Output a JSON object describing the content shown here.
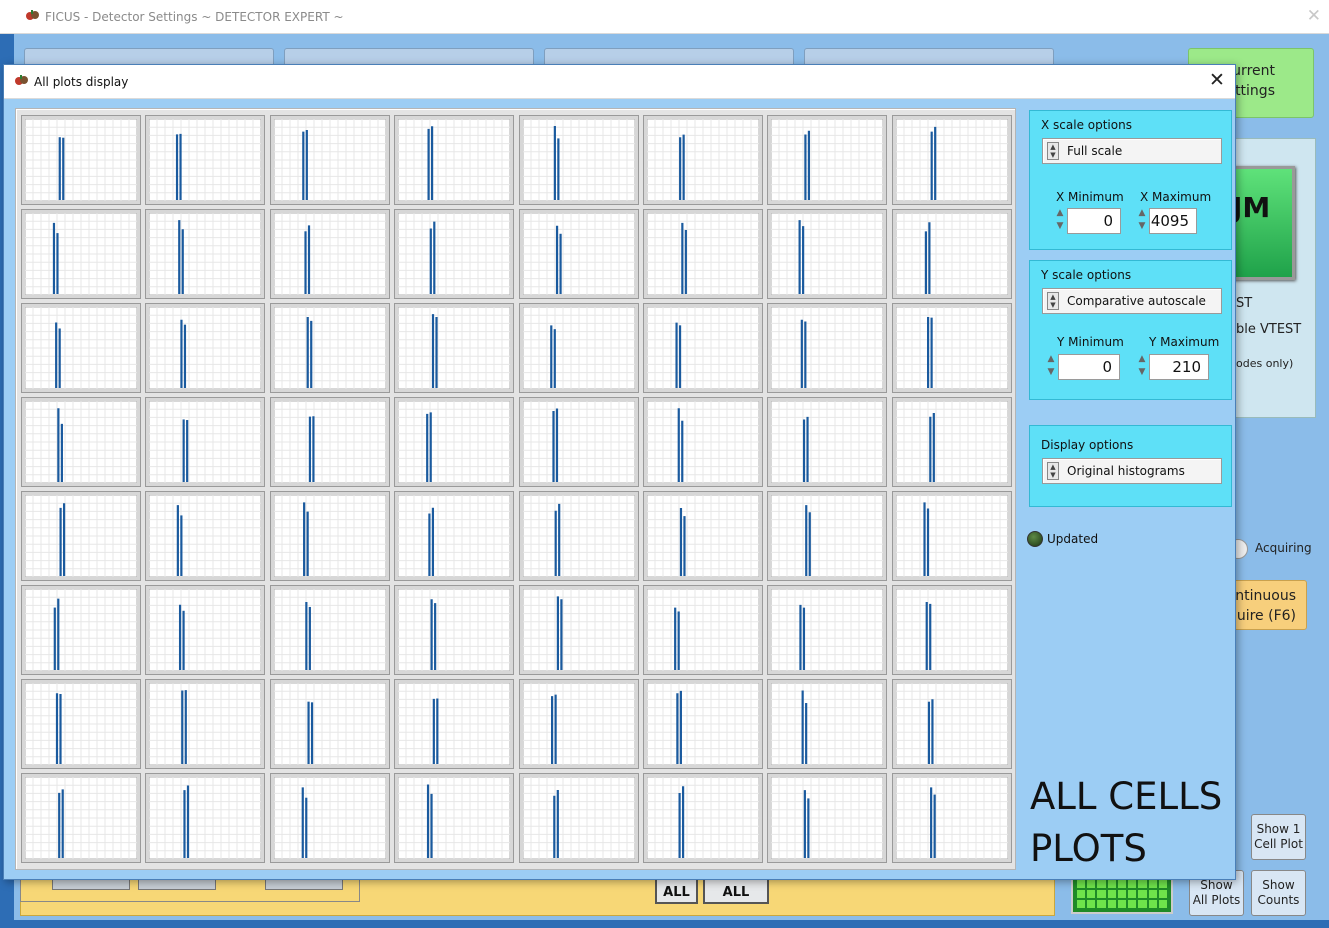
{
  "main_window": {
    "title": "FICUS - Detector Settings ~ DETECTOR EXPERT ~",
    "close_glyph": "✕",
    "update_settings_label": "...e current settings",
    "update_settings_line1": "e current",
    "update_settings_line2": "ettings",
    "big_button_label": "JM",
    "right_text_1": "ST",
    "right_text_2": "ble VTEST",
    "right_text_3": "odes only)",
    "acquiring_label": "Acquiring",
    "acquire_line1": "ntinuous",
    "acquire_line2": "quire (F6)",
    "show1_line1": "Show 1",
    "show1_line2": "Cell Plot",
    "show_all_line1": "Show",
    "show_all_line2": "All Plots",
    "show_counts_line1": "Show",
    "show_counts_line2": "Counts",
    "all_label_1": "ALL",
    "all_label_2": "ALL"
  },
  "dialog": {
    "title": "All plots display",
    "close_glyph": "✕",
    "x_scale": {
      "title": "X scale options",
      "mode": "Full scale",
      "min_label": "X Minimum",
      "max_label": "X Maximum",
      "min": "0",
      "max": "4095"
    },
    "y_scale": {
      "title": "Y scale options",
      "mode": "Comparative autoscale",
      "min_label": "Y Minimum",
      "max_label": "Y Maximum",
      "min": "0",
      "max": "210"
    },
    "display": {
      "title": "Display options",
      "mode": "Original histograms"
    },
    "updated_label": "Updated",
    "big_label_line1": "ALL CELLS",
    "big_label_line2": "PLOTS"
  },
  "colors": {
    "peak": "#1a5a9e",
    "panel": "#5ee0f7",
    "dialog_bg": "#9ccdf4"
  },
  "icons": {
    "app": "ficus-app-icon",
    "close": "close-icon",
    "ring_arrows": "up-down-arrows-icon",
    "led": "led-indicator-icon"
  },
  "grid": {
    "rows": 8,
    "cols": 8
  }
}
